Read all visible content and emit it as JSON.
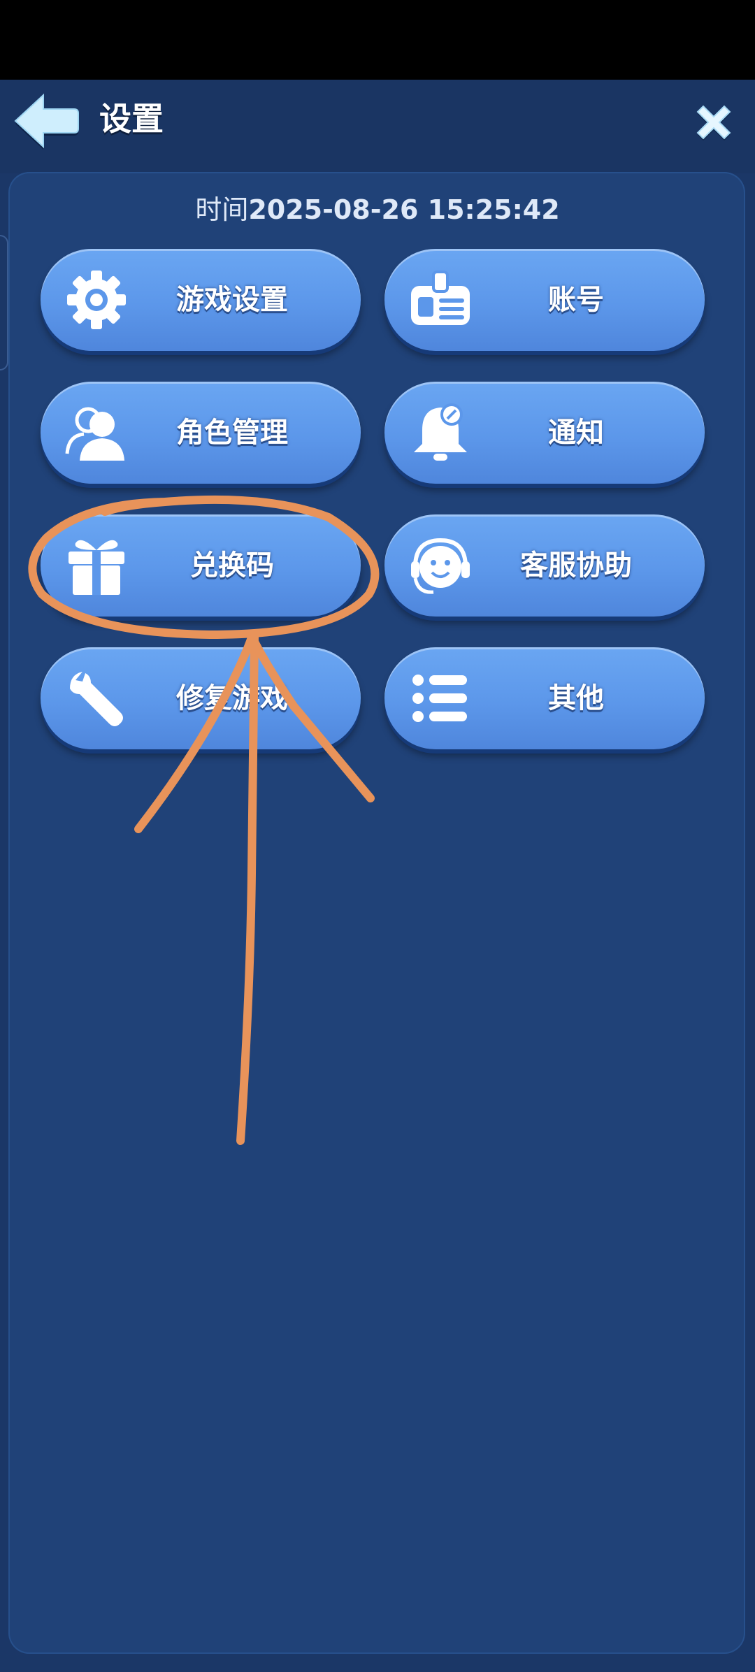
{
  "header": {
    "title": "设置",
    "back_icon": "arrow-left-icon",
    "close_icon": "close-icon"
  },
  "time": {
    "label": "时间",
    "value": "2025-08-26 15:25:42"
  },
  "menu": [
    {
      "label": "游戏设置",
      "icon": "gear-icon"
    },
    {
      "label": "账号",
      "icon": "id-card-icon"
    },
    {
      "label": "角色管理",
      "icon": "users-icon"
    },
    {
      "label": "通知",
      "icon": "bell-icon"
    },
    {
      "label": "兑换码",
      "icon": "gift-icon"
    },
    {
      "label": "客服协助",
      "icon": "headset-icon"
    },
    {
      "label": "修复游戏",
      "icon": "wrench-icon"
    },
    {
      "label": "其他",
      "icon": "list-icon"
    }
  ],
  "colors": {
    "background": "#1b3767",
    "panel": "#204278",
    "button": "#5c97ea",
    "annotation": "#e8935a"
  }
}
